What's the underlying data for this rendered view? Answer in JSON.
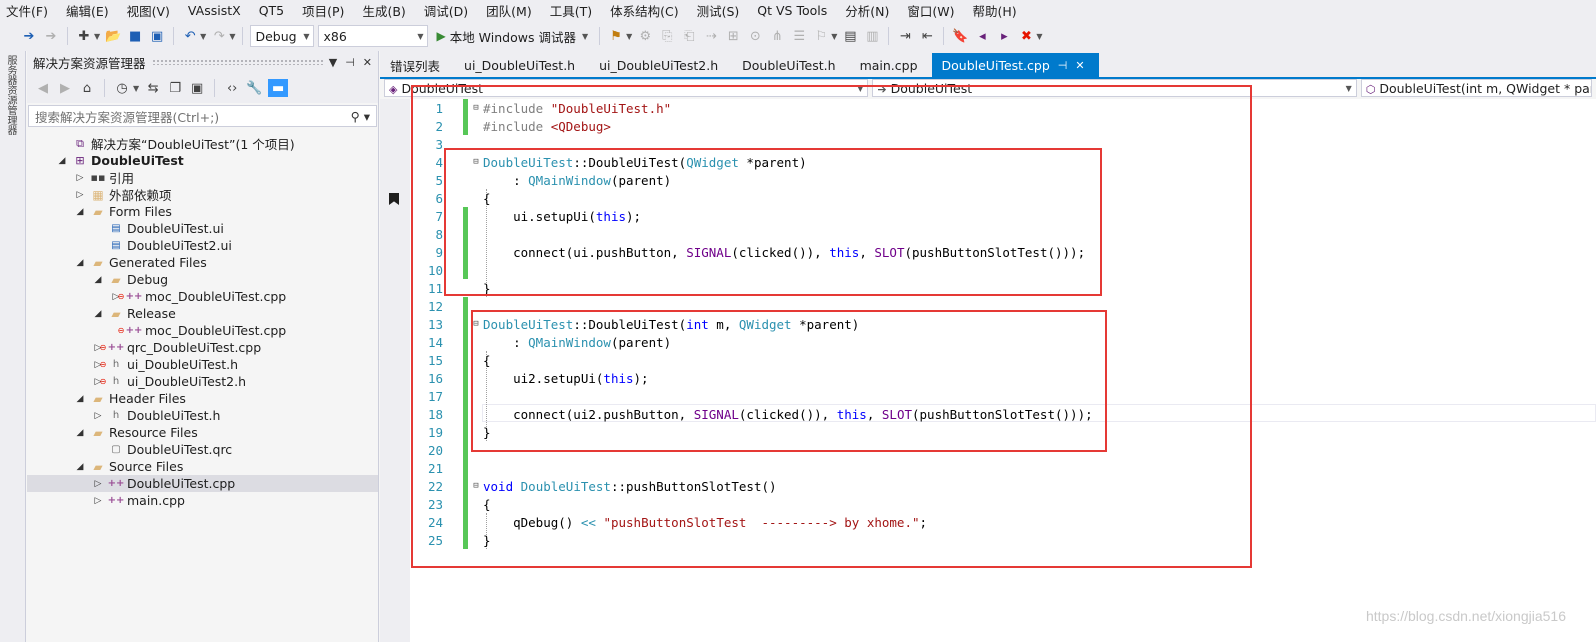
{
  "menu": [
    "文件(F)",
    "编辑(E)",
    "视图(V)",
    "VAssistX",
    "QT5",
    "项目(P)",
    "生成(B)",
    "调试(D)",
    "团队(M)",
    "工具(T)",
    "体系结构(C)",
    "测试(S)",
    "Qt VS Tools",
    "分析(N)",
    "窗口(W)",
    "帮助(H)"
  ],
  "toolbar": {
    "config": "Debug",
    "platform": "x86",
    "run_label": "本地 Windows 调试器"
  },
  "left_strip": {
    "label": "服务器资源管理器"
  },
  "solution_explorer": {
    "title": "解决方案资源管理器",
    "search_placeholder": "搜索解决方案资源管理器(Ctrl+;)",
    "nodes": [
      {
        "label": "解决方案“DoubleUiTest”(1 个项目)",
        "icon": "solution-icon",
        "depth": 0,
        "twisty": ""
      },
      {
        "label": "DoubleUiTest",
        "icon": "project-icon",
        "depth": 0,
        "twisty": "open",
        "bold": true
      },
      {
        "label": "引用",
        "icon": "references-icon",
        "depth": 1,
        "twisty": "closed"
      },
      {
        "label": "外部依赖项",
        "icon": "external-deps-icon",
        "depth": 1,
        "twisty": "closed"
      },
      {
        "label": "Form Files",
        "icon": "folder-icon",
        "depth": 1,
        "twisty": "open"
      },
      {
        "label": "DoubleUiTest.ui",
        "icon": "ui-file-icon",
        "depth": 2,
        "twisty": ""
      },
      {
        "label": "DoubleUiTest2.ui",
        "icon": "ui-file-icon",
        "depth": 2,
        "twisty": ""
      },
      {
        "label": "Generated Files",
        "icon": "folder-icon",
        "depth": 1,
        "twisty": "open"
      },
      {
        "label": "Debug",
        "icon": "folder-icon",
        "depth": 2,
        "twisty": "open"
      },
      {
        "label": "moc_DoubleUiTest.cpp",
        "icon": "cpp-file-icon",
        "depth": 3,
        "twisty": "closed",
        "red": true
      },
      {
        "label": "Release",
        "icon": "folder-icon",
        "depth": 2,
        "twisty": "open"
      },
      {
        "label": "moc_DoubleUiTest.cpp",
        "icon": "cpp-file-icon",
        "depth": 3,
        "twisty": "",
        "red": true,
        "excluded": true
      },
      {
        "label": "qrc_DoubleUiTest.cpp",
        "icon": "cpp-file-icon",
        "depth": 2,
        "twisty": "closed",
        "red": true
      },
      {
        "label": "ui_DoubleUiTest.h",
        "icon": "header-file-icon",
        "depth": 2,
        "twisty": "closed",
        "red": true
      },
      {
        "label": "ui_DoubleUiTest2.h",
        "icon": "header-file-icon",
        "depth": 2,
        "twisty": "closed",
        "red": true
      },
      {
        "label": "Header Files",
        "icon": "folder-icon",
        "depth": 1,
        "twisty": "open"
      },
      {
        "label": "DoubleUiTest.h",
        "icon": "header-file-icon",
        "depth": 2,
        "twisty": "closed"
      },
      {
        "label": "Resource Files",
        "icon": "folder-icon",
        "depth": 1,
        "twisty": "open"
      },
      {
        "label": "DoubleUiTest.qrc",
        "icon": "resource-file-icon",
        "depth": 2,
        "twisty": ""
      },
      {
        "label": "Source Files",
        "icon": "folder-icon",
        "depth": 1,
        "twisty": "open"
      },
      {
        "label": "DoubleUiTest.cpp",
        "icon": "cpp-file-icon",
        "depth": 2,
        "twisty": "closed",
        "selected": true
      },
      {
        "label": "main.cpp",
        "icon": "cpp-file-icon",
        "depth": 2,
        "twisty": "closed"
      }
    ]
  },
  "tabs": [
    "错误列表",
    "ui_DoubleUiTest.h",
    "ui_DoubleUiTest2.h",
    "DoubleUiTest.h",
    "main.cpp",
    "DoubleUiTest.cpp"
  ],
  "active_tab": "DoubleUiTest.cpp",
  "nav": {
    "scope": "DoubleUiTest",
    "member_scope": "DoubleUiTest",
    "function": "DoubleUiTest(int m, QWidget * parent)"
  },
  "code_lines": [
    {
      "n": "1",
      "fold": "⊟",
      "green": true,
      "tokens": [
        [
          "pp",
          "#include "
        ],
        [
          "st",
          "\"DoubleUiTest.h\""
        ]
      ]
    },
    {
      "n": "2",
      "fold": "",
      "green": true,
      "tokens": [
        [
          "pp",
          "#include "
        ],
        [
          "st",
          "<QDebug>"
        ]
      ]
    },
    {
      "n": "3",
      "fold": "",
      "green": false,
      "tokens": []
    },
    {
      "n": "4",
      "fold": "⊟",
      "green": false,
      "tokens": [
        [
          "ty",
          "DoubleUiTest"
        ],
        [
          "",
          "::DoubleUiTest("
        ],
        [
          "ty",
          "QWidget"
        ],
        [
          "",
          " *parent)"
        ]
      ]
    },
    {
      "n": "5",
      "fold": "",
      "green": false,
      "tokens": [
        [
          "",
          "    : "
        ],
        [
          "ty",
          "QMainWindow"
        ],
        [
          "",
          "(parent)"
        ]
      ]
    },
    {
      "n": "6",
      "fold": "",
      "green": false,
      "tokens": [
        [
          "",
          "{"
        ]
      ]
    },
    {
      "n": "7",
      "fold": "",
      "green": true,
      "tokens": [
        [
          "",
          "    ui.setupUi("
        ],
        [
          "kw",
          "this"
        ],
        [
          "",
          ");"
        ]
      ]
    },
    {
      "n": "8",
      "fold": "",
      "green": true,
      "tokens": []
    },
    {
      "n": "9",
      "fold": "",
      "green": true,
      "tokens": [
        [
          "",
          "    connect(ui.pushButton, "
        ],
        [
          "mc",
          "SIGNAL"
        ],
        [
          "",
          "(clicked()), "
        ],
        [
          "kw",
          "this"
        ],
        [
          "",
          ", "
        ],
        [
          "mc",
          "SLOT"
        ],
        [
          "",
          "(pushButtonSlotTest()));"
        ]
      ]
    },
    {
      "n": "10",
      "fold": "",
      "green": true,
      "tokens": []
    },
    {
      "n": "11",
      "fold": "",
      "green": false,
      "tokens": [
        [
          "",
          "}"
        ]
      ]
    },
    {
      "n": "12",
      "fold": "",
      "green": true,
      "tokens": []
    },
    {
      "n": "13",
      "fold": "⊟",
      "green": true,
      "tokens": [
        [
          "ty",
          "DoubleUiTest"
        ],
        [
          "",
          "::DoubleUiTest("
        ],
        [
          "kw",
          "int"
        ],
        [
          "",
          " m, "
        ],
        [
          "ty",
          "QWidget"
        ],
        [
          "",
          " *parent)"
        ]
      ]
    },
    {
      "n": "14",
      "fold": "",
      "green": true,
      "tokens": [
        [
          "",
          "    : "
        ],
        [
          "ty",
          "QMainWindow"
        ],
        [
          "",
          "(parent)"
        ]
      ]
    },
    {
      "n": "15",
      "fold": "",
      "green": true,
      "tokens": [
        [
          "",
          "{"
        ]
      ]
    },
    {
      "n": "16",
      "fold": "",
      "green": true,
      "tokens": [
        [
          "",
          "    ui2.setupUi("
        ],
        [
          "kw",
          "this"
        ],
        [
          "",
          ");"
        ]
      ]
    },
    {
      "n": "17",
      "fold": "",
      "green": true,
      "tokens": []
    },
    {
      "n": "18",
      "fold": "",
      "green": true,
      "tokens": [
        [
          "",
          "    connect(ui2.pushButton, "
        ],
        [
          "mc",
          "SIGNAL"
        ],
        [
          "",
          "(clicked()), "
        ],
        [
          "kw",
          "this"
        ],
        [
          "",
          ", "
        ],
        [
          "mc",
          "SLOT"
        ],
        [
          "",
          "(pushButtonSlotTest()));"
        ]
      ]
    },
    {
      "n": "19",
      "fold": "",
      "green": true,
      "tokens": [
        [
          "",
          "}"
        ]
      ]
    },
    {
      "n": "20",
      "fold": "",
      "green": true,
      "tokens": []
    },
    {
      "n": "21",
      "fold": "",
      "green": true,
      "tokens": []
    },
    {
      "n": "22",
      "fold": "⊟",
      "green": true,
      "tokens": [
        [
          "kw",
          "void"
        ],
        [
          "",
          " "
        ],
        [
          "ty",
          "DoubleUiTest"
        ],
        [
          "",
          "::pushButtonSlotTest()"
        ]
      ]
    },
    {
      "n": "23",
      "fold": "",
      "green": true,
      "tokens": [
        [
          "",
          "{"
        ]
      ]
    },
    {
      "n": "24",
      "fold": "",
      "green": true,
      "tokens": [
        [
          "",
          "    qDebug() "
        ],
        [
          "ty",
          "<<"
        ],
        [
          "",
          " "
        ],
        [
          "st",
          "\"pushButtonSlotTest  ---------> by xhome.\""
        ],
        [
          "",
          ";"
        ]
      ]
    },
    {
      "n": "25",
      "fold": "",
      "green": true,
      "tokens": [
        [
          "",
          "}"
        ]
      ]
    }
  ],
  "watermark": "https://blog.csdn.net/xiongjia516",
  "colors": {
    "accent": "#007acc",
    "annotation": "#e53935",
    "change_bar": "#57c757"
  }
}
